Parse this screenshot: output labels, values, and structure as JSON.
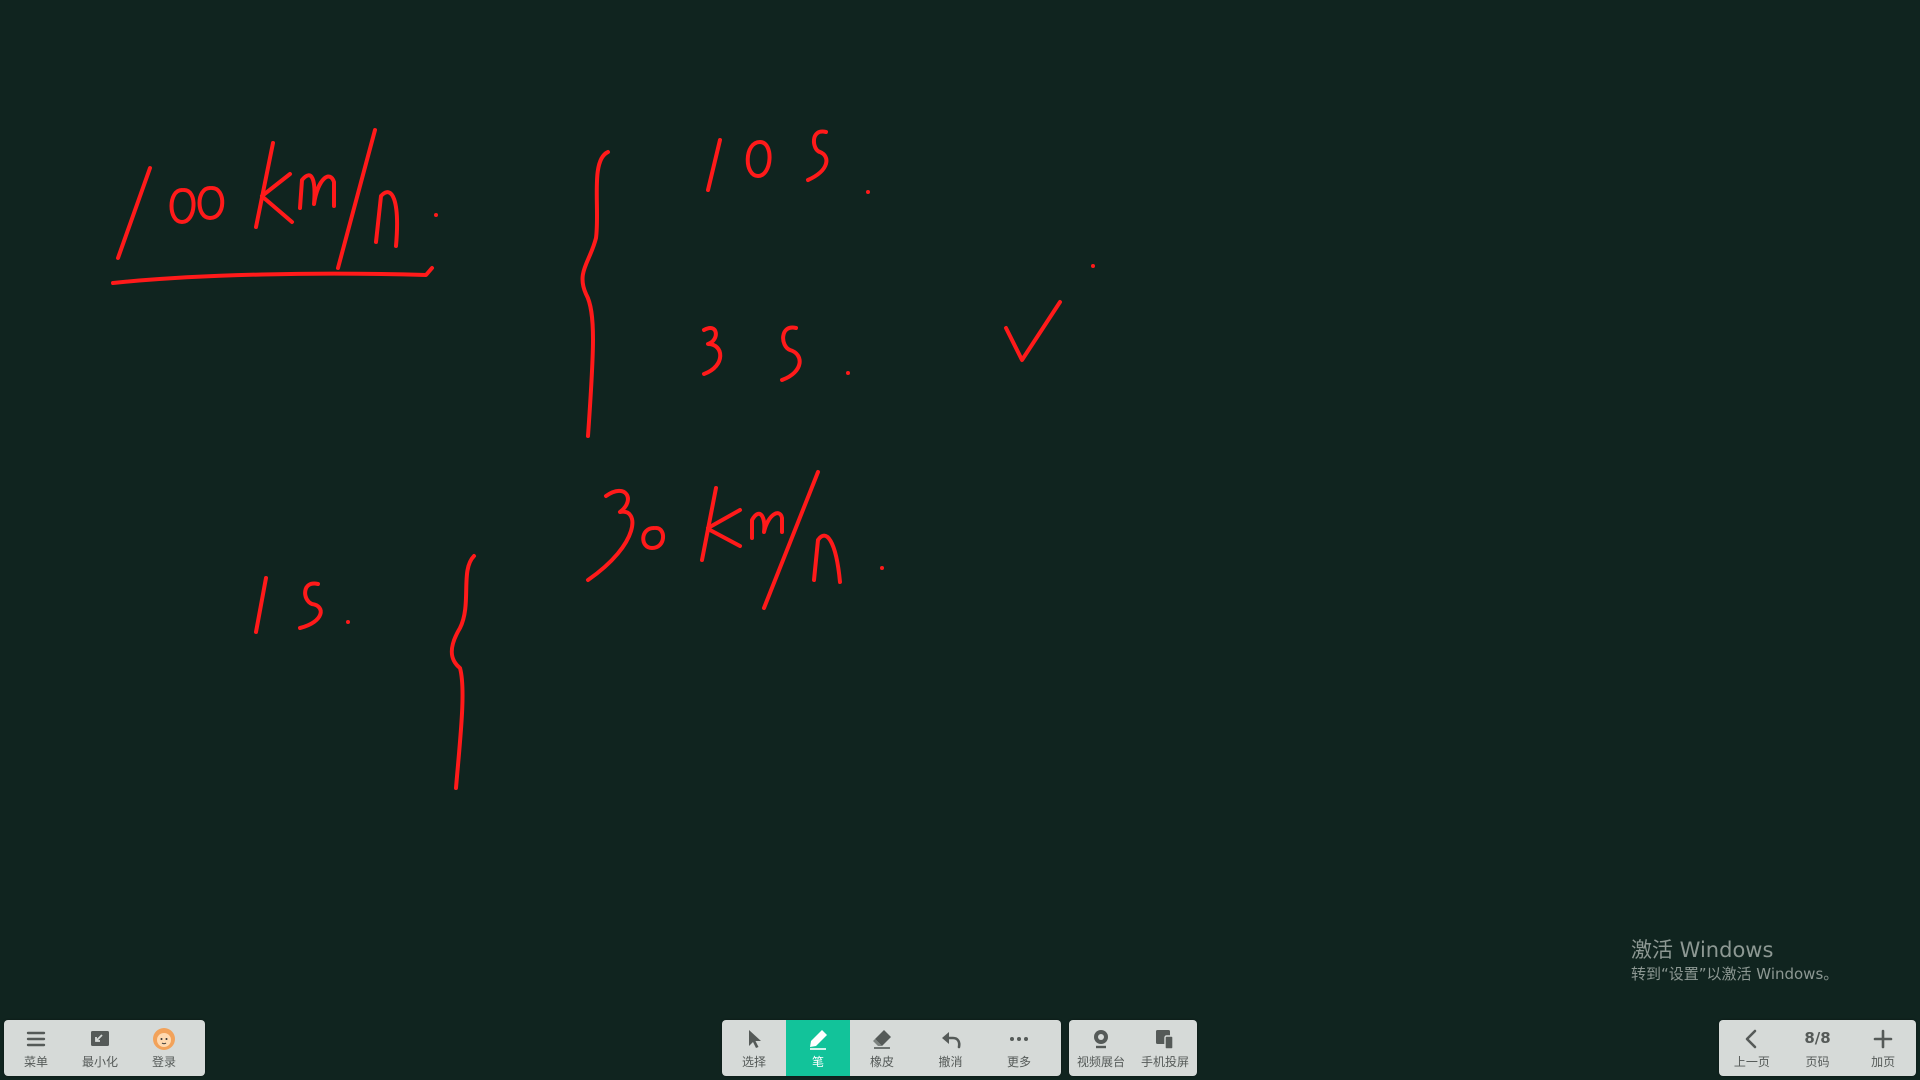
{
  "board": {
    "ink_color": "#ff1a1a",
    "background": "#10241f"
  },
  "watermark": {
    "title": "激活 Windows",
    "subtitle": "转到“设置”以激活 Windows。"
  },
  "toolbar_left": {
    "menu_label": "菜单",
    "minimize_label": "最小化",
    "login_label": "登录"
  },
  "toolbar_center": {
    "select_label": "选择",
    "pen_label": "笔",
    "eraser_label": "橡皮",
    "undo_label": "撤消",
    "more_label": "更多",
    "active_tool": "pen",
    "accent_color": "#12c39a"
  },
  "toolbar_screen": {
    "camera_label": "视频展台",
    "phone_label": "手机投屏"
  },
  "toolbar_right": {
    "prev_label": "上一页",
    "page_number": "8/8",
    "page_label": "页码",
    "add_label": "加页"
  }
}
